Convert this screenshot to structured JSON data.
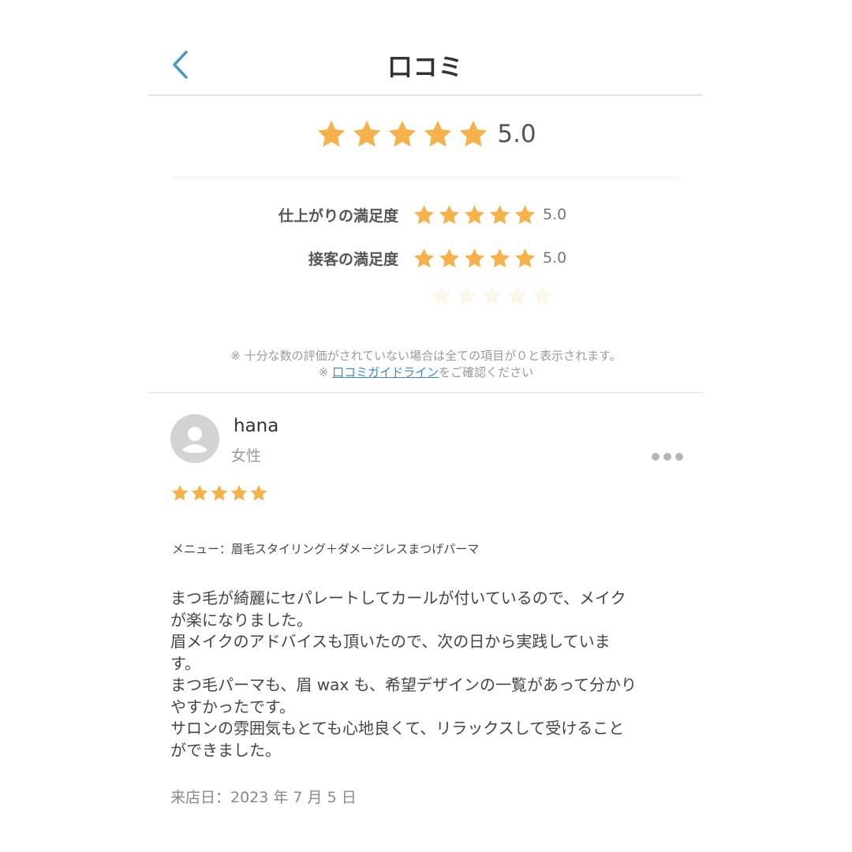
{
  "header": {
    "title": "口コミ",
    "back_icon": "chevron-left-icon",
    "accent_color": "#4a98bc"
  },
  "overall": {
    "stars": 5,
    "value": "5.0",
    "star_color": "#f6b24a"
  },
  "criteria": [
    {
      "label": "仕上がりの満足度",
      "stars": 5,
      "value": "5.0"
    },
    {
      "label": "接客の満足度",
      "stars": 5,
      "value": "5.0"
    }
  ],
  "notes": {
    "line1": "※ 十分な数の評価がされていない場合は全ての項目が０と表示されます。",
    "line2_prefix": "※",
    "guideline_link": "口コミガイドライン",
    "line2_suffix": "をご確認ください"
  },
  "review": {
    "avatar_icon": "user-avatar-icon",
    "username": "hana",
    "gender": "女性",
    "more_icon": "more-horizontal-icon",
    "stars": 5,
    "menu": "メニュー：眉毛スタイリング＋ダメージレスまつげパーマ",
    "body_lines": [
      "まつ毛が綺麗にセパレートしてカールが付いているので、メイク",
      "が楽になりました。",
      "眉メイクのアドバイスも頂いたので、次の日から実践していま",
      "す。",
      "まつ毛パーマも、眉 wax も、希望デザインの一覧があって分かり",
      "やすかったです。",
      "サロンの雰囲気もとても心地良くて、リラックスして受けること",
      "ができました。"
    ],
    "visit_date": "来店日：2023 年 7 月 5 日"
  }
}
